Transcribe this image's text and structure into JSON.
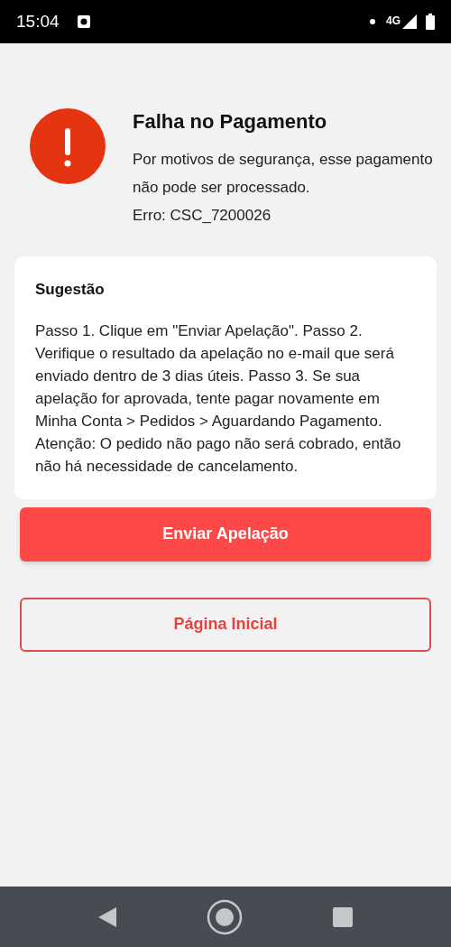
{
  "status_bar": {
    "time": "15:04",
    "network": "4G"
  },
  "error": {
    "title": "Falha no Pagamento",
    "message": "Por motivos de segurança, esse pagamento não pode ser processado.",
    "code": "Erro: CSC_7200026"
  },
  "suggestion": {
    "title": "Sugestão",
    "text": "Passo 1. Clique em \"Enviar Apelação\". Passo 2. Verifique o resultado da apelação no e-mail que será enviado dentro de 3 dias úteis. Passo 3. Se sua apelação for aprovada, tente pagar novamente em Minha Conta > Pedidos > Aguardando Pagamento. Atenção: O pedido não pago não será cobrado, então não há necessidade de cancelamento."
  },
  "buttons": [
    {
      "label": "Enviar Apelação",
      "kind": "primary"
    },
    {
      "label": "Página Inicial",
      "kind": "outline"
    }
  ]
}
